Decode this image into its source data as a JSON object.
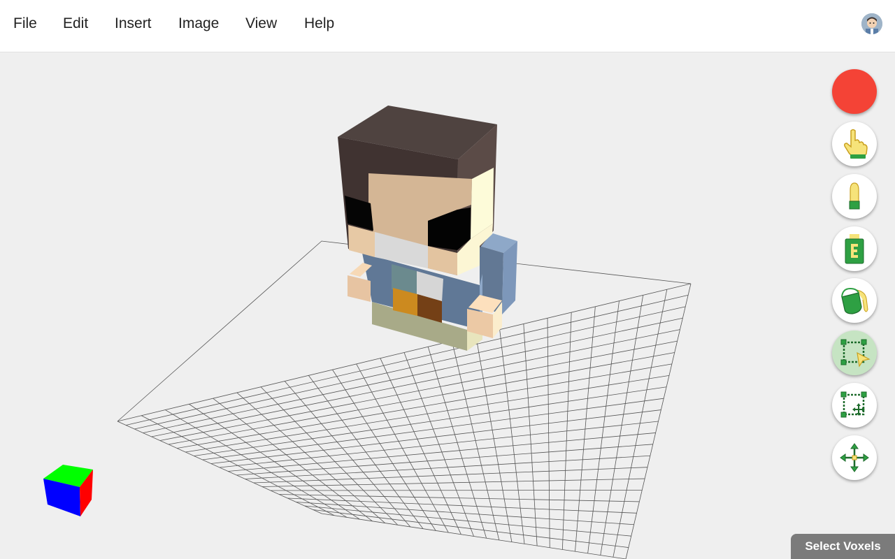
{
  "menu": {
    "items": [
      "File",
      "Edit",
      "Insert",
      "Image",
      "View",
      "Help"
    ]
  },
  "user": {
    "avatar_icon": "user-avatar-icon"
  },
  "toolbar": {
    "current_color": "#f44336",
    "tools": [
      {
        "name": "color-picker",
        "icon": "color-swatch-icon",
        "active": false
      },
      {
        "name": "pointer",
        "icon": "hand-pointer-icon",
        "active": false
      },
      {
        "name": "add-voxel",
        "icon": "crayon-icon",
        "active": false
      },
      {
        "name": "eraser",
        "icon": "eraser-icon",
        "active": false
      },
      {
        "name": "paint-bucket",
        "icon": "paint-bucket-icon",
        "active": false
      },
      {
        "name": "select-voxels",
        "icon": "select-region-icon",
        "active": true
      },
      {
        "name": "move-selection",
        "icon": "move-selection-icon",
        "active": false
      },
      {
        "name": "pan",
        "icon": "move-arrows-icon",
        "active": false
      }
    ]
  },
  "status": {
    "mode_label": "Select Voxels"
  },
  "orientation_cube": {
    "top_color": "#00ff00",
    "front_color": "#0000ff",
    "side_color": "#ff0000"
  }
}
